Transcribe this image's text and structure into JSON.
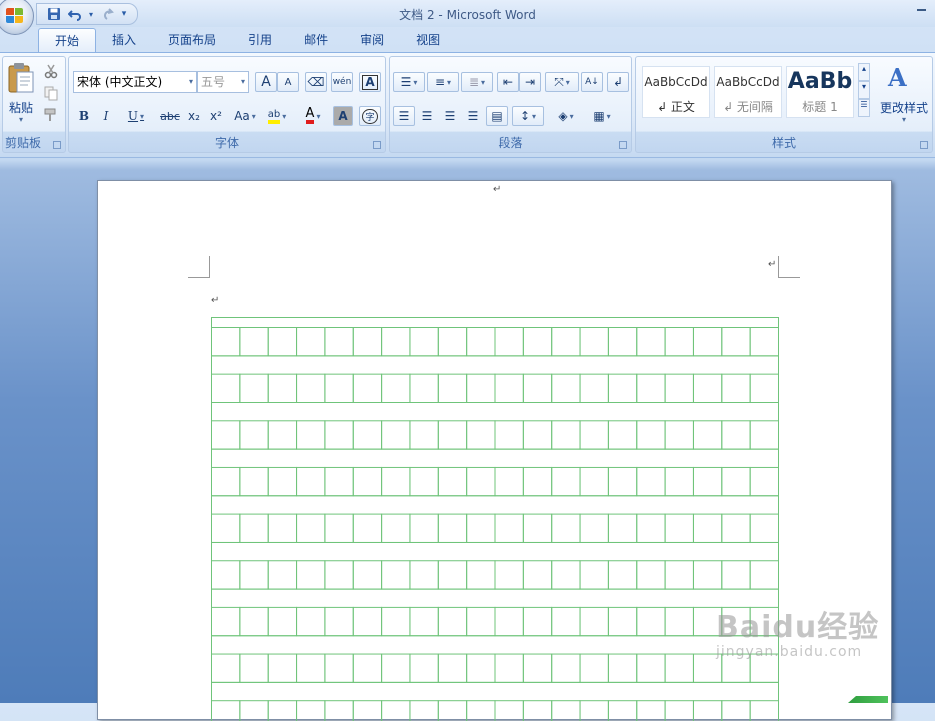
{
  "window": {
    "title": "文档 2 - Microsoft Word"
  },
  "quick_access": [
    {
      "name": "save-icon",
      "glyph": "💾"
    },
    {
      "name": "undo-icon",
      "glyph": "↶"
    },
    {
      "name": "redo-icon",
      "glyph": "↷"
    },
    {
      "name": "customize-icon",
      "glyph": "▾"
    }
  ],
  "tabs": [
    "开始",
    "插入",
    "页面布局",
    "引用",
    "邮件",
    "审阅",
    "视图"
  ],
  "active_tab": "开始",
  "groups": {
    "clipboard": {
      "title": "剪贴板",
      "paste_label": "粘贴"
    },
    "font": {
      "title": "字体",
      "font_name": "宋体 (中文正文)",
      "font_size": "五号"
    },
    "paragraph": {
      "title": "段落"
    },
    "styles": {
      "title": "样式",
      "change_styles_label": "更改样式",
      "cards": [
        {
          "sample": "AaBbCcDd",
          "name": "↲ 正文"
        },
        {
          "sample": "AaBbCcDd",
          "name": "↲ 无间隔"
        },
        {
          "sample": "AaBb",
          "name": "标题 1"
        }
      ]
    }
  },
  "font_buttons": {
    "bold": "B",
    "italic": "I",
    "underline": "U",
    "strike": "abc",
    "sub": "x₂",
    "sup": "x²",
    "case": "Aa",
    "grow": "A",
    "shrink": "A",
    "phonetic": "wén"
  },
  "document": {
    "paragraph_mark": "↵",
    "grid_color": "#6fc47a"
  },
  "watermark": {
    "line1": "Baidu经验",
    "line2": "jingyan.baidu.com"
  }
}
